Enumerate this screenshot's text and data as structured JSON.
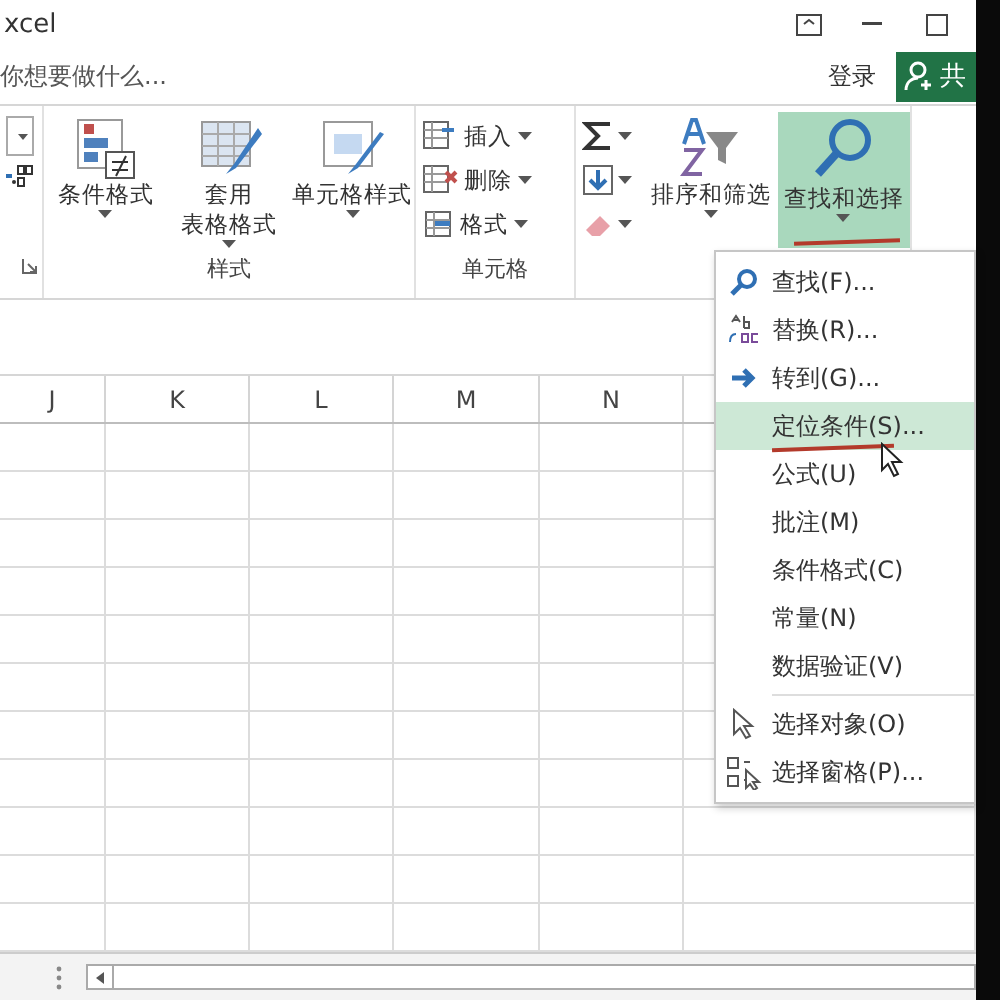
{
  "window": {
    "title": "xcel",
    "signin": "登录",
    "share": "共"
  },
  "tell_me": {
    "placeholder": "你想要做什么..."
  },
  "ribbon": {
    "groups": [
      {
        "kind": "partial"
      },
      {
        "kind": "big",
        "label": "样式",
        "buttons": [
          {
            "kind": "conditional",
            "lines": [
              "条件格式"
            ]
          },
          {
            "kind": "table",
            "lines": [
              "套用",
              "表格格式"
            ]
          },
          {
            "kind": "cellstyle",
            "lines": [
              "单元格样式"
            ]
          }
        ]
      },
      {
        "kind": "list",
        "label": "单元格",
        "buttons": [
          {
            "kind": "insert",
            "lines": [
              "插入"
            ]
          },
          {
            "kind": "delete",
            "lines": [
              "删除"
            ]
          },
          {
            "kind": "format",
            "lines": [
              "格式"
            ]
          }
        ]
      },
      {
        "kind": "editing",
        "tools": [
          {
            "kind": "sum"
          },
          {
            "kind": "fill"
          },
          {
            "kind": "clear"
          }
        ],
        "buttons": [
          {
            "kind": "sort",
            "lines": [
              "排序和筛选"
            ],
            "selected": false,
            "marked": false
          },
          {
            "kind": "find",
            "lines": [
              "查找和选择"
            ],
            "selected": true,
            "marked": true
          }
        ]
      }
    ]
  },
  "columns": [
    "J",
    "K",
    "L",
    "M",
    "N"
  ],
  "menu": {
    "sections": [
      [
        {
          "kind": "find",
          "label": "查找(F)...",
          "highlighted": false,
          "marked": false
        },
        {
          "kind": "replace",
          "label": "替换(R)...",
          "highlighted": false,
          "marked": false
        },
        {
          "kind": "goto",
          "label": "转到(G)...",
          "highlighted": false,
          "marked": false
        },
        {
          "kind": "plain",
          "label": "定位条件(S)...",
          "highlighted": true,
          "marked": true
        },
        {
          "kind": "plain",
          "label": "公式(U)",
          "highlighted": false,
          "marked": false
        },
        {
          "kind": "plain",
          "label": "批注(M)",
          "highlighted": false,
          "marked": false
        },
        {
          "kind": "plain",
          "label": "条件格式(C)",
          "highlighted": false,
          "marked": false
        },
        {
          "kind": "plain",
          "label": "常量(N)",
          "highlighted": false,
          "marked": false
        },
        {
          "kind": "plain",
          "label": "数据验证(V)",
          "highlighted": false,
          "marked": false
        }
      ],
      [
        {
          "kind": "pointer",
          "label": "选择对象(O)",
          "highlighted": false,
          "marked": false
        },
        {
          "kind": "pane",
          "label": "选择窗格(P)...",
          "highlighted": false,
          "marked": false
        }
      ]
    ]
  }
}
